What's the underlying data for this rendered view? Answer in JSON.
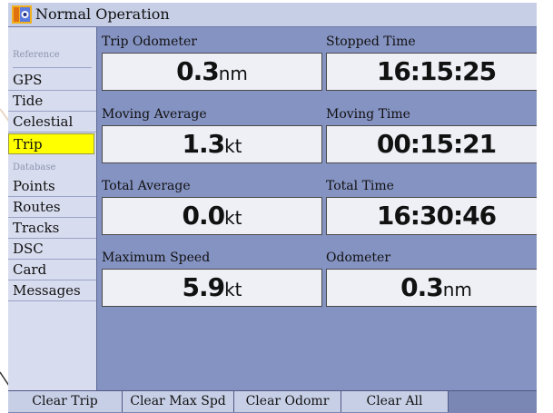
{
  "window": {
    "title": "Normal Operation",
    "icon": "trip-app-icon"
  },
  "sidebar": {
    "section_reference": "Reference",
    "section_database": "Database",
    "items": [
      {
        "label": "GPS"
      },
      {
        "label": "Tide"
      },
      {
        "label": "Celestial"
      },
      {
        "label": "Trip",
        "selected": true
      },
      {
        "label": "Points"
      },
      {
        "label": "Routes"
      },
      {
        "label": "Tracks"
      },
      {
        "label": "DSC"
      },
      {
        "label": "Card"
      },
      {
        "label": "Messages"
      }
    ]
  },
  "fields": [
    {
      "label": "Trip Odometer",
      "value": "0.3",
      "unit": "nm"
    },
    {
      "label": "Stopped Time",
      "value": "16:15:25",
      "unit": ""
    },
    {
      "label": "Moving Average",
      "value": "1.3",
      "unit": "kt"
    },
    {
      "label": "Moving Time",
      "value": "00:15:21",
      "unit": ""
    },
    {
      "label": "Total Average",
      "value": "0.0",
      "unit": "kt"
    },
    {
      "label": "Total Time",
      "value": "16:30:46",
      "unit": ""
    },
    {
      "label": "Maximum Speed",
      "value": "5.9",
      "unit": "kt"
    },
    {
      "label": "Odometer",
      "value": "0.3",
      "unit": "nm"
    }
  ],
  "buttons": {
    "clear_trip": "Clear Trip",
    "clear_max_spd": "Clear Max Spd",
    "clear_odomr": "Clear Odomr",
    "clear_all": "Clear All"
  },
  "colors": {
    "background": "#8593c2",
    "sidebar": "#d7dcee",
    "selected": "#ffff00",
    "title_bar": "#c7cfe6"
  }
}
